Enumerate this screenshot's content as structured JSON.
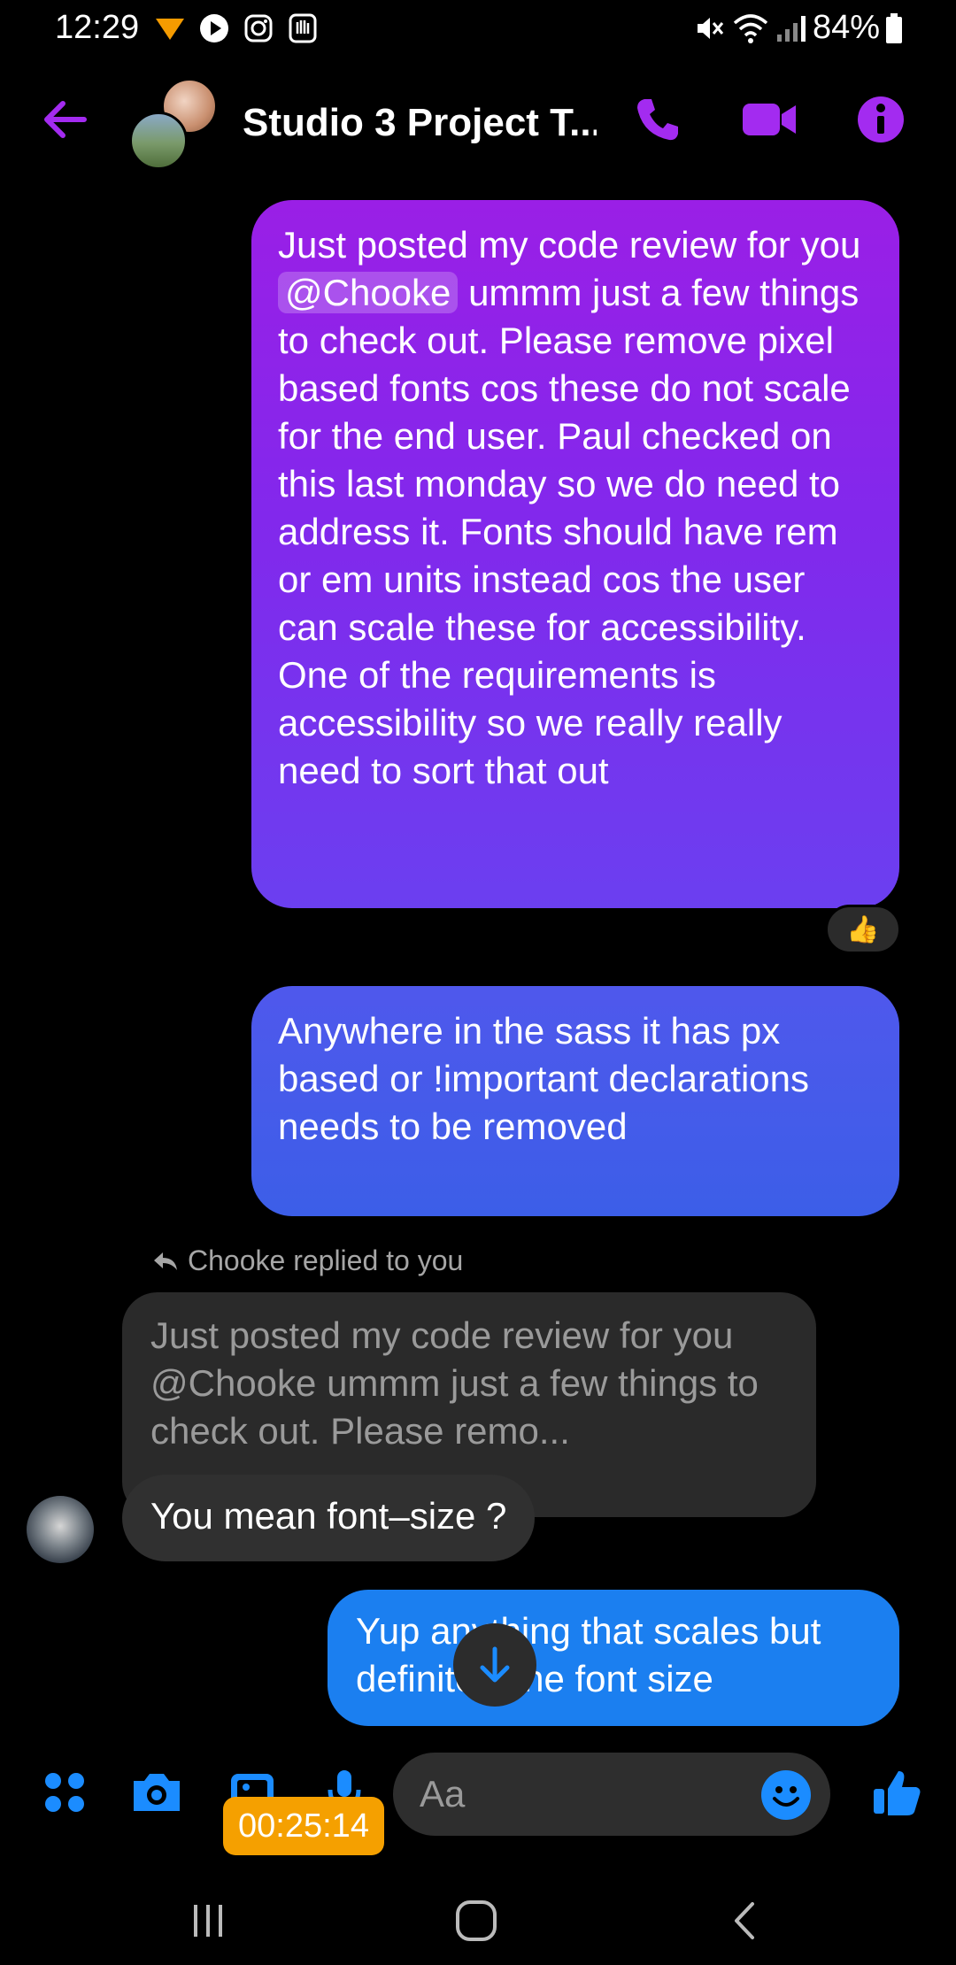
{
  "status_bar": {
    "time": "12:29",
    "battery": "84%",
    "icons": [
      "app-notification-icon",
      "play-icon",
      "instagram-icon",
      "hand-icon",
      "mute-icon",
      "wifi-icon",
      "signal-icon",
      "battery-icon"
    ]
  },
  "header": {
    "title": "Studio 3 Project T...",
    "icons": [
      "back-arrow-icon",
      "phone-icon",
      "video-icon",
      "info-icon"
    ],
    "accent_color": "#a32bf0"
  },
  "messages": {
    "m1": {
      "pre": "Just posted my code review for you ",
      "mention": "@Chooke",
      "post": " ummm just a few things to check out. Please remove pixel based fonts cos these do not scale for the end user. Paul checked on this last monday so we do need to address it. Fonts should have rem or em units instead cos the user can scale these for accessibility. One of the requirements is accessibility so we really really need to sort that out",
      "reaction": "👍"
    },
    "m2": {
      "text": "Anywhere in the sass it has px based or !important declarations needs to be removed"
    },
    "reply": {
      "label": "Chooke replied to you",
      "quoted": "Just posted my code review for you @Chooke ummm just a few things to check out. Please remo...",
      "text": "You mean font–size ?"
    },
    "m4": {
      "text": "Yup anything that scales but definitely the font size"
    }
  },
  "composer": {
    "placeholder": "Aa",
    "timer": "00:25:14",
    "icons": [
      "menu-dots-icon",
      "camera-icon",
      "gallery-icon",
      "microphone-icon",
      "emoji-icon",
      "thumbs-up-icon"
    ]
  },
  "colors": {
    "bubble_purple": "#9a1fe6",
    "bubble_indigo": "#4f58ec",
    "bubble_blue": "#1b7ff0",
    "messenger_blue": "#1b8cff",
    "timer_orange": "#f5a000"
  }
}
